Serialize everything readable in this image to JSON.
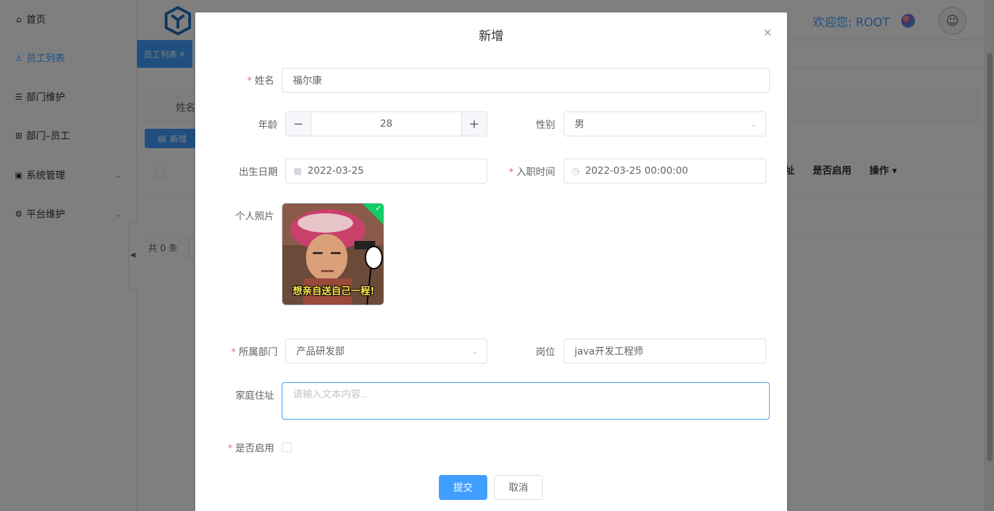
{
  "sidebar": {
    "items": [
      {
        "label": "首页",
        "icon": "home-icon"
      },
      {
        "label": "员工列表",
        "icon": "user-icon",
        "active": true
      },
      {
        "label": "部门维护",
        "icon": "list-icon"
      },
      {
        "label": "部门–员工",
        "icon": "tree-icon"
      },
      {
        "label": "系统管理",
        "icon": "monitor-icon",
        "expandable": true
      },
      {
        "label": "平台维护",
        "icon": "gear-icon",
        "expandable": true
      }
    ]
  },
  "header": {
    "welcome": "欢迎您: ROOT"
  },
  "tabs": [
    {
      "label": "员工列表",
      "close": "×"
    }
  ],
  "list_page": {
    "search_label": "姓名",
    "add_button": "新增",
    "columns": [
      "址",
      "是否启用",
      "操作"
    ],
    "total": "共 0 条"
  },
  "dialog": {
    "title": "新增",
    "close_icon": "×",
    "fields": {
      "name": {
        "label": "姓名",
        "required": true,
        "value": "福尔康"
      },
      "age": {
        "label": "年龄",
        "value": "28",
        "minus": "−",
        "plus": "+"
      },
      "gender": {
        "label": "性别",
        "value": "男"
      },
      "birthday": {
        "label": "出生日期",
        "value": "2022-03-25"
      },
      "hire_time": {
        "label": "入职时间",
        "required": true,
        "value": "2022-03-25 00:00:00"
      },
      "photo": {
        "label": "个人照片",
        "caption": "想亲自送自己一程!"
      },
      "department": {
        "label": "所属部门",
        "required": true,
        "value": "产品研发部"
      },
      "position": {
        "label": "岗位",
        "value": "java开发工程师"
      },
      "address": {
        "label": "家庭住址",
        "placeholder": "请输入文本内容.."
      },
      "enabled": {
        "label": "是否启用",
        "required": true,
        "checked": false
      }
    },
    "submit": "提交",
    "cancel": "取消"
  },
  "colors": {
    "primary": "#409eff",
    "required": "#f56c6c",
    "success": "#13ce66",
    "overlay": "rgba(0,0,0,0.5)"
  }
}
